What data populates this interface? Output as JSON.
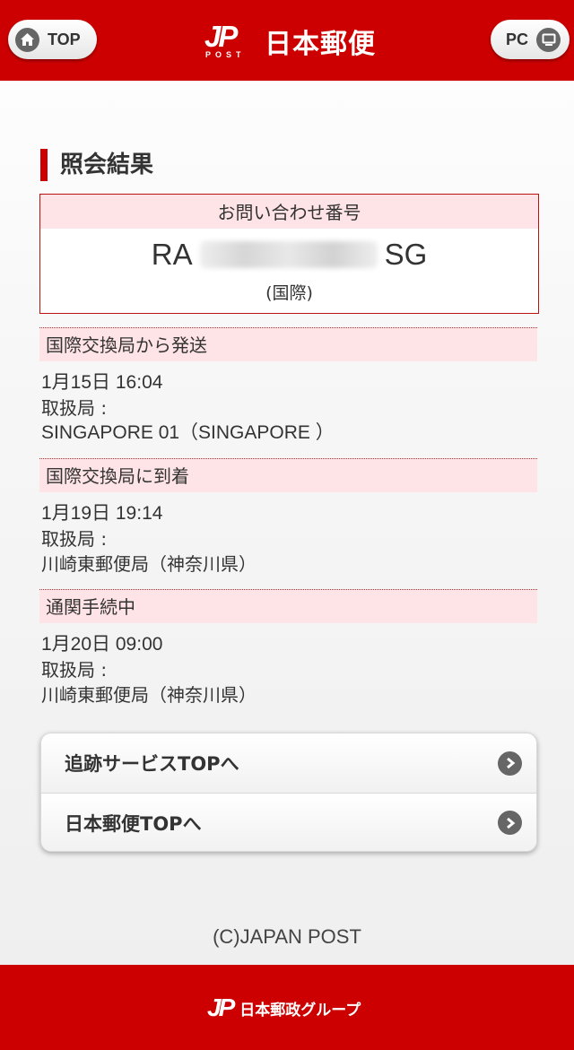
{
  "header": {
    "top_button": "TOP",
    "pc_button": "PC",
    "logo_mark": "JP",
    "logo_sub": "POST",
    "logo_text": "日本郵便",
    "brand_color": "#cc0000"
  },
  "section_title": "照会結果",
  "inquiry": {
    "label": "お問い合わせ番号",
    "number_prefix": "RA",
    "number_suffix": "SG",
    "type": "(国際)"
  },
  "events": [
    {
      "status": "国際交換局から発送",
      "datetime": "1月15日 16:04",
      "office_label": "取扱局 :",
      "office": "SINGAPORE 01（SINGAPORE ）"
    },
    {
      "status": "国際交換局に到着",
      "datetime": "1月19日 19:14",
      "office_label": "取扱局 :",
      "office": "川崎東郵便局（神奈川県）"
    },
    {
      "status": "通関手続中",
      "datetime": "1月20日 09:00",
      "office_label": "取扱局 :",
      "office": "川崎東郵便局（神奈川県）"
    }
  ],
  "links": [
    {
      "label": "追跡サービスTOPへ"
    },
    {
      "label": "日本郵便TOPへ"
    }
  ],
  "copyright": "(C)JAPAN POST",
  "footer": {
    "logo_mark": "JP",
    "logo_text": "日本郵政グループ"
  }
}
